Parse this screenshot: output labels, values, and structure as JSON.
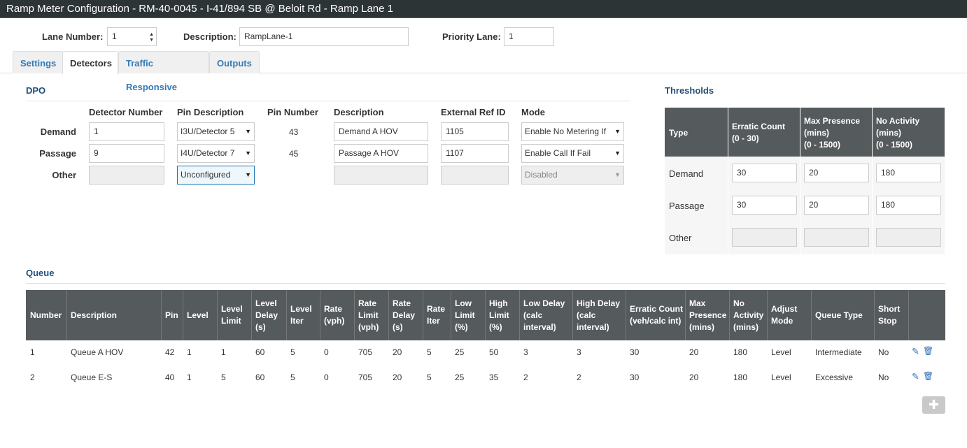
{
  "window": {
    "title": "Ramp Meter Configuration - RM-40-0045 - I-41/894 SB @ Beloit Rd - Ramp Lane 1"
  },
  "header": {
    "lane_number_label": "Lane Number:",
    "lane_number_value": "1",
    "description_label": "Description:",
    "description_value": "RampLane-1",
    "priority_lane_label": "Priority Lane:",
    "priority_lane_value": "1"
  },
  "tabs": [
    {
      "label": "Settings",
      "active": false
    },
    {
      "label": "Detectors",
      "active": true
    },
    {
      "label": "Traffic Responsive",
      "active": false
    },
    {
      "label": "Outputs",
      "active": false
    }
  ],
  "dpo": {
    "title": "DPO",
    "columns": [
      "Detector Number",
      "Pin Description",
      "Pin Number",
      "Description",
      "External Ref ID",
      "Mode"
    ],
    "rows": [
      {
        "label": "Demand",
        "detector_number": "1",
        "pin_description": "I3U/Detector 5",
        "pin_number": "43",
        "description": "Demand A HOV",
        "external_ref_id": "1105",
        "mode": "Enable No Metering If"
      },
      {
        "label": "Passage",
        "detector_number": "9",
        "pin_description": "I4U/Detector 7",
        "pin_number": "45",
        "description": "Passage A HOV",
        "external_ref_id": "1107",
        "mode": "Enable Call If Fail"
      },
      {
        "label": "Other",
        "detector_number": "",
        "pin_description": "Unconfigured",
        "pin_number": "",
        "description": "",
        "external_ref_id": "",
        "mode": "Disabled"
      }
    ]
  },
  "thresholds": {
    "title": "Thresholds",
    "headers": {
      "type": "Type",
      "erratic_count": [
        "Erratic Count",
        "(0 - 30)"
      ],
      "max_presence": [
        "Max Presence",
        "(mins)",
        "(0 - 1500)"
      ],
      "no_activity": [
        "No Activity",
        "(mins)",
        "(0 - 1500)"
      ]
    },
    "rows": [
      {
        "label": "Demand",
        "erratic_count": "30",
        "max_presence": "20",
        "no_activity": "180"
      },
      {
        "label": "Passage",
        "erratic_count": "30",
        "max_presence": "20",
        "no_activity": "180"
      },
      {
        "label": "Other",
        "erratic_count": "",
        "max_presence": "",
        "no_activity": ""
      }
    ]
  },
  "queue": {
    "title": "Queue",
    "headers": [
      [
        "Number"
      ],
      [
        "Description"
      ],
      [
        "Pin"
      ],
      [
        "Level"
      ],
      [
        "Level",
        "Limit"
      ],
      [
        "Level",
        "Delay",
        "(s)"
      ],
      [
        "Level",
        "Iter"
      ],
      [
        "Rate",
        "(vph)"
      ],
      [
        "Rate",
        "Limit",
        "(vph)"
      ],
      [
        "Rate",
        "Delay",
        "(s)"
      ],
      [
        "Rate",
        "Iter"
      ],
      [
        "Low",
        "Limit",
        "(%)"
      ],
      [
        "High",
        "Limit",
        "(%)"
      ],
      [
        "Low Delay",
        " (calc",
        "interval)"
      ],
      [
        "High Delay",
        "(calc",
        "interval)"
      ],
      [
        "Erratic Count",
        "(veh/calc int)"
      ],
      [
        "Max",
        "Presence",
        "(mins)"
      ],
      [
        "No",
        "Activity",
        "(mins)"
      ],
      [
        "Adjust",
        "Mode"
      ],
      [
        "Queue Type"
      ],
      [
        "Short",
        "Stop"
      ]
    ],
    "rows": [
      [
        "1",
        "Queue A HOV",
        "42",
        "1",
        "1",
        "60",
        "5",
        "0",
        "705",
        "20",
        "5",
        "25",
        "50",
        "3",
        "3",
        "30",
        "20",
        "180",
        "Level",
        "Intermediate",
        "No"
      ],
      [
        "2",
        "Queue E-S",
        "40",
        "1",
        "5",
        "60",
        "5",
        "0",
        "705",
        "20",
        "5",
        "25",
        "35",
        "2",
        "2",
        "30",
        "20",
        "180",
        "Level",
        "Excessive",
        "No"
      ]
    ],
    "row_icons": [
      "pencil-icon",
      "trash-icon"
    ],
    "add_icon": "plus-icon"
  },
  "colors": {
    "titlebar": "#2d3436",
    "link_blue": "#337ab7",
    "section_title": "#1f4e79",
    "table_header": "#555a5d",
    "icon_blue": "#2a6ebb"
  }
}
